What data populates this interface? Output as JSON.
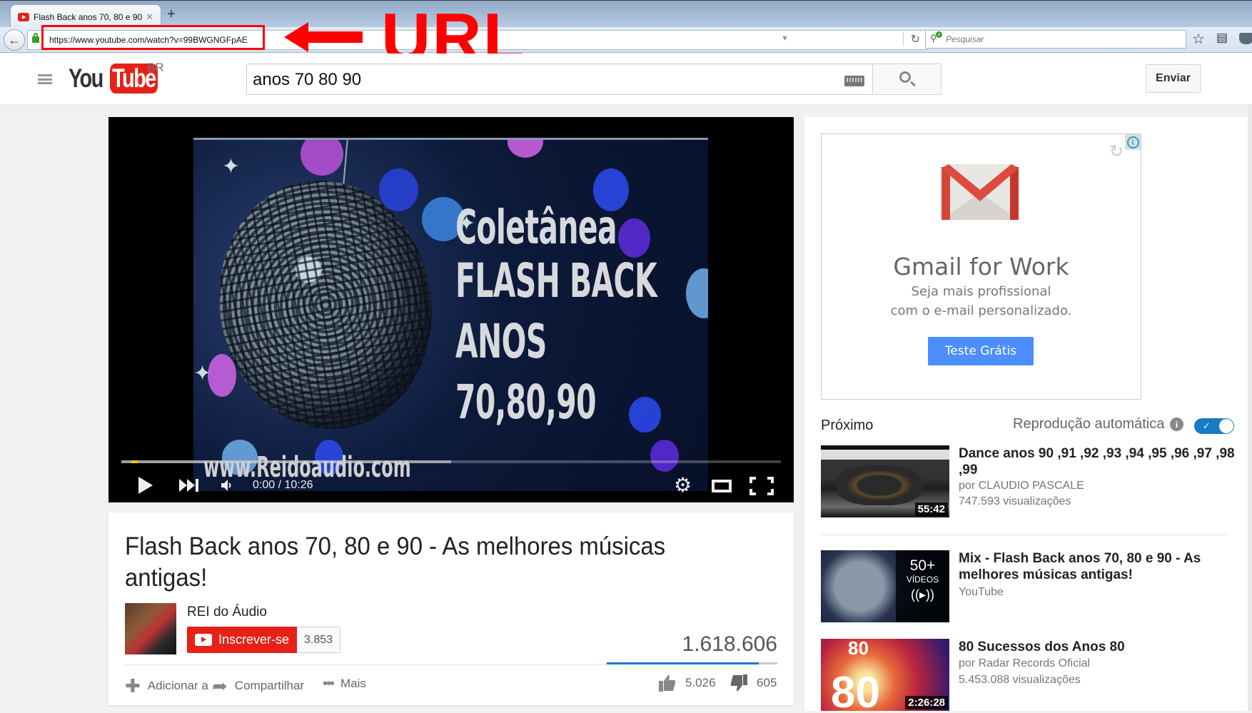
{
  "browser": {
    "tab_title": "Flash Back anos 70, 80 e 90 ...",
    "tab_close": "✕",
    "new_tab": "+",
    "url": "https://www.youtube.com/watch?v=99BWGNGFpAE",
    "search_placeholder": "Pesquisar"
  },
  "annotation": {
    "label": "URL",
    "color": "#ff0000"
  },
  "header": {
    "logo_you": "You",
    "logo_tube": "Tube",
    "country": "BR",
    "search_value": "anos 70 80 90",
    "upload_label": "Enviar"
  },
  "player": {
    "overlay_lines": [
      "Coletânea",
      "FLASH BACK",
      "ANOS",
      "70,80,90"
    ],
    "watermark": "www.Reidoaudio.com",
    "time_display": "0:00 / 10:26",
    "current_time": "0:00",
    "duration": "10:26",
    "buffered_fraction": 0.5,
    "played_fraction": 0.0
  },
  "video": {
    "title": "Flash Back anos 70, 80 e 90 - As melhores músicas antigas!",
    "channel": "REI do Áudio",
    "subscribe_label": "Inscrever-se",
    "subscriber_count": "3.853",
    "views": "1.618.606",
    "likes": "5.026",
    "dislikes": "605",
    "like_fraction": 0.893,
    "actions": {
      "add_to": "Adicionar a",
      "share": "Compartilhar",
      "more": "Mais"
    }
  },
  "ad": {
    "title": "Gmail for Work",
    "line1": "Seja mais profissional",
    "line2": "com o e-mail personalizado.",
    "cta": "Teste Grátis"
  },
  "sidebar": {
    "up_next_label": "Próximo",
    "autoplay_label": "Reprodução automática",
    "autoplay_on": true,
    "videos": [
      {
        "title": "Dance anos 90 ,91 ,92 ,93 ,94 ,95 ,96 ,97 ,98 ,99",
        "channel": "por CLAUDIO PASCALE",
        "views": "747.593 visualizações",
        "duration": "55:42"
      },
      {
        "title": "Mix - Flash Back anos 70, 80 e 90 - As melhores músicas antigas!",
        "channel": "YouTube",
        "playlist_count": "50+",
        "playlist_label": "VÍDEOS"
      },
      {
        "title": "80 Sucessos dos Anos 80",
        "channel": "por Radar Records Oficial",
        "views": "5.453.088 visualizações",
        "duration": "2:26:28"
      }
    ]
  }
}
